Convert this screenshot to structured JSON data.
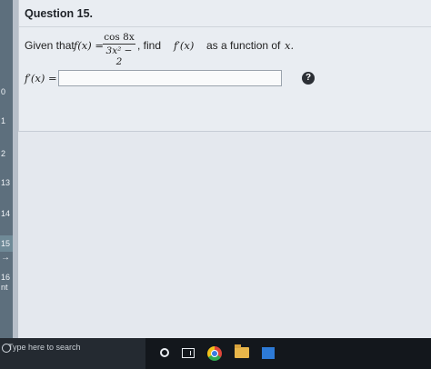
{
  "side_nav": {
    "items": [
      {
        "label": "0",
        "active": false
      },
      {
        "label": "1",
        "active": false
      },
      {
        "label": "2",
        "active": false
      },
      {
        "label": "13",
        "active": false
      },
      {
        "label": "14",
        "active": false
      },
      {
        "label": "15",
        "active": true
      },
      {
        "label": "→",
        "active": false
      },
      {
        "label": "16",
        "active": false
      },
      {
        "label": "nt",
        "active": false
      }
    ]
  },
  "question": {
    "title": "Question 15.",
    "prompt_given": "Given that",
    "f_of_x": "f(x) =",
    "numerator": "cos 8x",
    "denominator": "3x² − 2",
    "prompt_find": ", find",
    "f_prime": "f′(x)",
    "prompt_tail": "as a function of",
    "var": "x.",
    "answer_label": "f′(x) =",
    "answer_value": "",
    "help_symbol": "?"
  },
  "taskbar": {
    "search_placeholder": "Type here to search",
    "icons": [
      "cortana-icon",
      "task-view-icon",
      "chrome-icon",
      "file-explorer-icon",
      "store-icon"
    ]
  },
  "colors": {
    "panel_bg": "#e9edf2",
    "sidebar_bg": "#5d6f7d",
    "taskbar_bg": "#13171c",
    "help_icon_bg": "#2b2f35"
  }
}
